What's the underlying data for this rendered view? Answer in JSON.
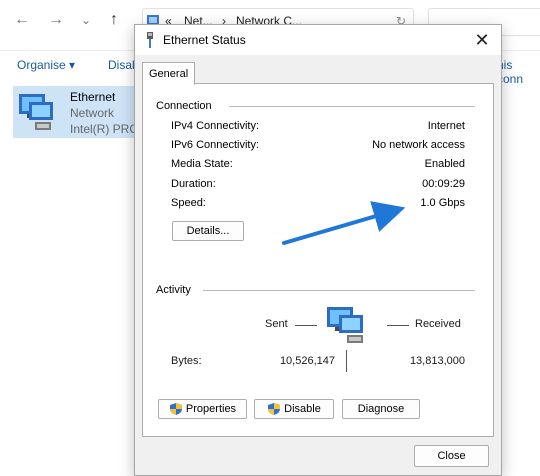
{
  "explorer": {
    "back_icon": "←",
    "forward_icon": "→",
    "dropdown_icon": "⌄",
    "up_icon": "↑",
    "breadcrumb_sep": "«",
    "breadcrumb_1": "Net...",
    "breadcrumb_arrow": "›",
    "breadcrumb_2": "Network C...",
    "refresh_icon": "↻",
    "cmd_organise": "Organise ▾",
    "cmd_disable": "Disab",
    "cmd_this_conn": "his conn",
    "item_name": "Ethernet",
    "item_type": "Network",
    "item_device": "Intel(R) PRO"
  },
  "dialog": {
    "title": "Ethernet Status",
    "close_glyph": "✕",
    "tab": "General",
    "connection": {
      "heading": "Connection",
      "rows": [
        {
          "label": "IPv4 Connectivity:",
          "value": "Internet"
        },
        {
          "label": "IPv6 Connectivity:",
          "value": "No network access"
        },
        {
          "label": "Media State:",
          "value": "Enabled"
        },
        {
          "label": "Duration:",
          "value": "00:09:29"
        },
        {
          "label": "Speed:",
          "value": "1.0 Gbps"
        }
      ],
      "details_button": "Details..."
    },
    "activity": {
      "heading": "Activity",
      "sent_label": "Sent",
      "received_label": "Received",
      "bytes_label": "Bytes:",
      "bytes_sent": "10,526,147",
      "bytes_received": "13,813,000"
    },
    "buttons": {
      "properties": "Properties",
      "disable": "Disable",
      "diagnose": "Diagnose",
      "close": "Close"
    }
  },
  "colors": {
    "annotation_arrow": "#1f78d8",
    "selection_bg": "#cfe3f7",
    "shield_blue": "#2f6fd0",
    "shield_yellow": "#f2c531"
  }
}
